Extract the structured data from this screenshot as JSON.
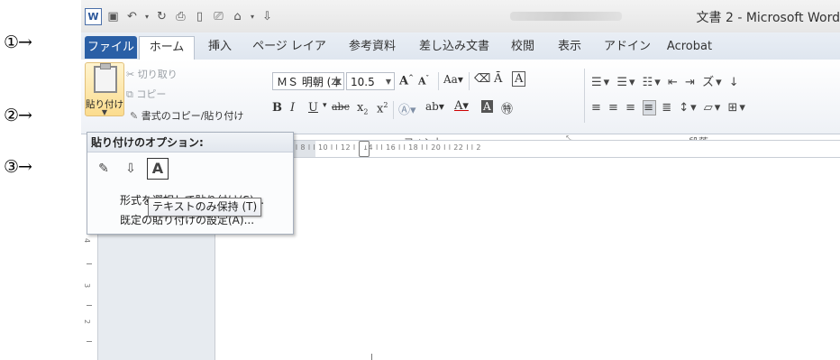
{
  "markers": [
    {
      "num": "①",
      "arrow": "→"
    },
    {
      "num": "②",
      "arrow": "→"
    },
    {
      "num": "③",
      "arrow": "→"
    }
  ],
  "title_bar": {
    "title": "文書 2 - Microsoft Word",
    "qat_icons": [
      "word-logo",
      "save-icon",
      "undo-icon",
      "redo-icon",
      "print-preview-icon",
      "new-doc-icon",
      "print-icon",
      "format-painter-icon",
      "customize-icon"
    ]
  },
  "tabs": [
    "ファイル",
    "ホーム",
    "挿入",
    "ページ レイアウト",
    "参考資料",
    "差し込み文書",
    "校閲",
    "表示",
    "アドイン",
    "Acrobat"
  ],
  "clipboard": {
    "paste_label": "貼り付け",
    "cut_label": "切り取り",
    "copy_label": "コピー",
    "format_painter_label": "書式のコピー/貼り付け"
  },
  "font": {
    "font_name": "ＭＳ 明朝 (本",
    "font_size": "10.5",
    "group_label": "フォント"
  },
  "paragraph": {
    "group_label": "段落"
  },
  "ruler": {
    "ticks": "4 l  l 2 l  l       l 2 l  l 4 l  l 6 l  l 8 l  l 10 l  l 12 l  l 14 l  l 16 l  l 18 l  l 20 l  l 22 l  l 2",
    "vertical_nums": [
      "4",
      "3",
      "2"
    ]
  },
  "paste_popup": {
    "header": "貼り付けのオプション:",
    "options": [
      {
        "name": "keep-source-formatting",
        "glyph": "✎"
      },
      {
        "name": "merge-formatting",
        "glyph": "⇩"
      },
      {
        "name": "keep-text-only",
        "glyph": "A"
      }
    ],
    "menu_item_1": "形式を選択して貼り付け(S)...",
    "menu_item_2": "既定の貼り付けの設定(A)...",
    "tooltip": "テキストのみ保持 (T)"
  }
}
